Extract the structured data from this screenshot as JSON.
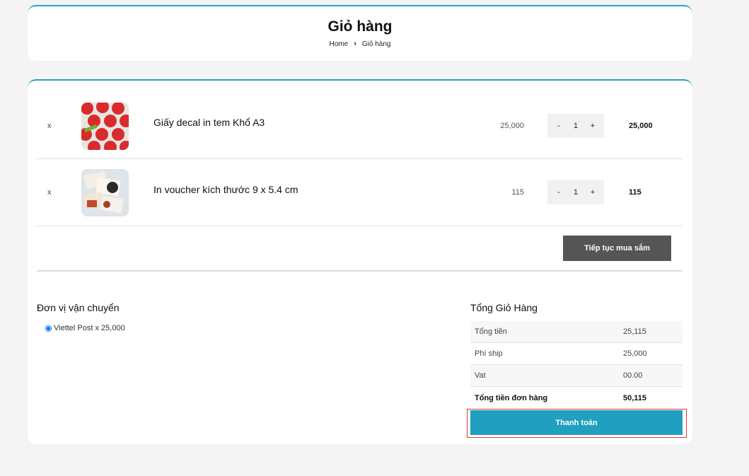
{
  "header": {
    "title": "Giỏ hàng",
    "breadcrumb": {
      "home": "Home",
      "current": "Giỏ hàng"
    }
  },
  "cart": {
    "items": [
      {
        "remove": "x",
        "name": "Giấy decal in tem Khổ A3",
        "price": "25,000",
        "qty_minus": "-",
        "quantity": "1",
        "qty_plus": "+",
        "subtotal": "25,000"
      },
      {
        "remove": "x",
        "name": "In voucher kích thước 9 x 5.4 cm",
        "price": "115",
        "qty_minus": "-",
        "quantity": "1",
        "qty_plus": "+",
        "subtotal": "115"
      }
    ],
    "continue_label": "Tiếp tục mua sắm"
  },
  "shipping": {
    "title": "Đơn vị vận chuyển",
    "option_label": "Viettel Post x 25,000"
  },
  "totals": {
    "title": "Tổng Giỏ Hàng",
    "rows": [
      {
        "label": "Tổng tiền",
        "value": "25,115"
      },
      {
        "label": "Phí ship",
        "value": "25,000"
      },
      {
        "label": "Vat",
        "value": "00.00"
      },
      {
        "label": "Tổng tiền đơn hàng",
        "value": "50,115"
      }
    ],
    "checkout_label": "Thanh toán"
  },
  "colors": {
    "accent": "#219fc0",
    "highlight_outline": "#d9383a",
    "continue_button": "#555555"
  }
}
